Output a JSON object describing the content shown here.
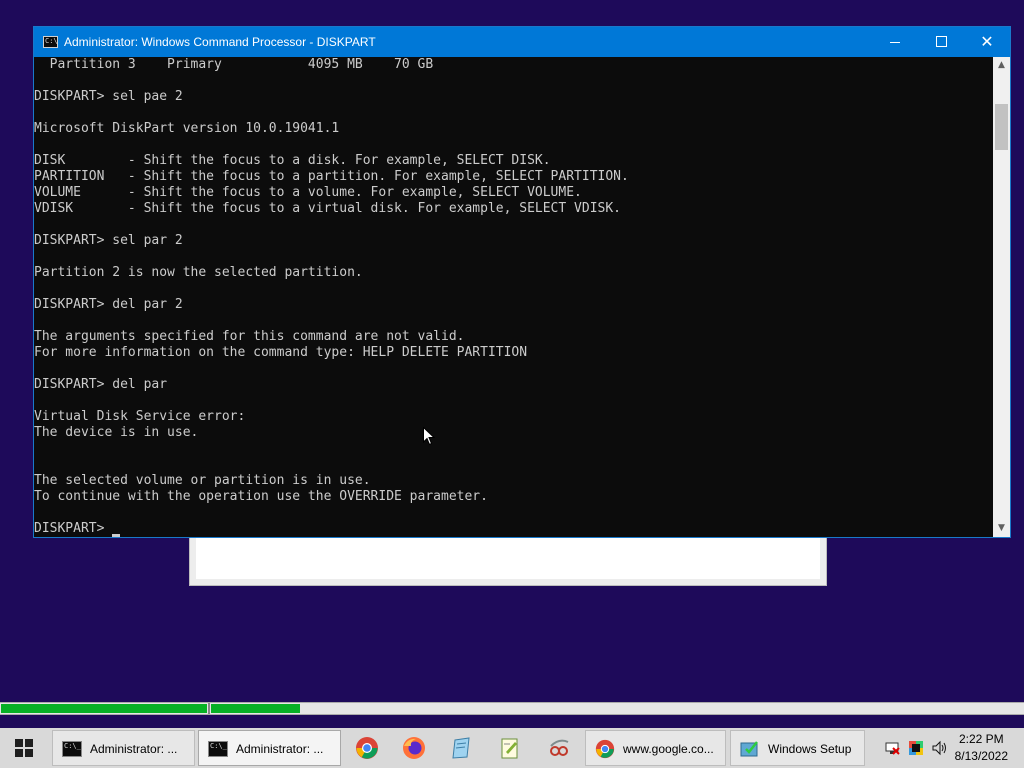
{
  "window": {
    "title": "Administrator: Windows Command Processor - DISKPART",
    "icon": "cmd-icon",
    "controls": {
      "minimize": "minimize-icon",
      "maximize": "maximize-icon",
      "close": "close-icon"
    }
  },
  "console": {
    "lines": [
      "  Partition 3    Primary           4095 MB    70 GB",
      "",
      "DISKPART> sel pae 2",
      "",
      "Microsoft DiskPart version 10.0.19041.1",
      "",
      "DISK        - Shift the focus to a disk. For example, SELECT DISK.",
      "PARTITION   - Shift the focus to a partition. For example, SELECT PARTITION.",
      "VOLUME      - Shift the focus to a volume. For example, SELECT VOLUME.",
      "VDISK       - Shift the focus to a virtual disk. For example, SELECT VDISK.",
      "",
      "DISKPART> sel par 2",
      "",
      "Partition 2 is now the selected partition.",
      "",
      "DISKPART> del par 2",
      "",
      "The arguments specified for this command are not valid.",
      "For more information on the command type: HELP DELETE PARTITION",
      "",
      "DISKPART> del par",
      "",
      "Virtual Disk Service error:",
      "The device is in use.",
      "",
      "",
      "The selected volume or partition is in use.",
      "To continue with the operation use the OVERRIDE parameter.",
      "",
      "DISKPART> "
    ]
  },
  "progress": {
    "segment1_fraction": 1.0,
    "segment2_fraction": 0.11
  },
  "taskbar": {
    "start_icon": "windows-logo-icon",
    "buttons": [
      {
        "label": "Administrator: ...",
        "icon": "cmd-icon"
      },
      {
        "label": "Administrator: ...",
        "icon": "cmd-icon",
        "active": true
      },
      {
        "label": "www.google.co...",
        "icon": "chrome-icon"
      },
      {
        "label": "Windows Setup",
        "icon": "setup-icon"
      }
    ],
    "pinned": [
      "chrome-icon",
      "firefox-icon",
      "notepad-icon",
      "notepad-plus-icon",
      "snipping-tool-icon"
    ],
    "tray": [
      "network-disconnected-icon",
      "color-picker-icon",
      "volume-icon"
    ],
    "clock": {
      "time": "2:22 PM",
      "date": "8/13/2022"
    }
  },
  "colors": {
    "desktop": "#1e0a5a",
    "titlebar": "#0078d7",
    "console_bg": "#0c0c0c",
    "console_fg": "#cccccc",
    "progress_green": "#06b025"
  }
}
